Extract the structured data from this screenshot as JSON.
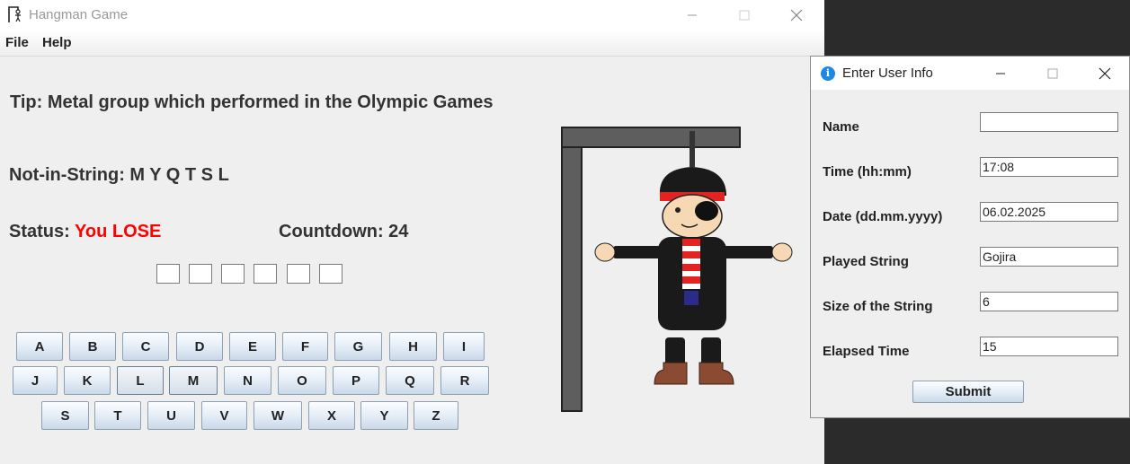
{
  "window": {
    "title": "Hangman Game",
    "icon": "hangman-icon"
  },
  "menu": {
    "items": [
      "File",
      "Help"
    ]
  },
  "game": {
    "tip": "Tip: Metal group which performed in the Olympic Games",
    "not_in_string": "Not-in-String: M Y Q T S L",
    "status_label": "Status:",
    "status_value": "You LOSE",
    "countdown": "Countdown: 24",
    "blanks": [
      "",
      "",
      "",
      "",
      "",
      ""
    ],
    "keyboard_rows": [
      [
        "A",
        "B",
        "C",
        "D",
        "E",
        "F",
        "G",
        "H",
        "I"
      ],
      [
        "J",
        "K",
        "L",
        "M",
        "N",
        "O",
        "P",
        "Q",
        "R"
      ],
      [
        "S",
        "T",
        "U",
        "V",
        "W",
        "X",
        "Y",
        "Z"
      ]
    ]
  },
  "dialog": {
    "title": "Enter User Info",
    "icon": "info-icon",
    "fields": [
      {
        "label": "Name",
        "value": ""
      },
      {
        "label": "Time (hh:mm)",
        "value": "17:08"
      },
      {
        "label": "Date (dd.mm.yyyy)",
        "value": "06.02.2025"
      },
      {
        "label": "Played String",
        "value": "Gojira"
      },
      {
        "label": "Size of the String",
        "value": "6"
      },
      {
        "label": "Elapsed Time",
        "value": "15"
      }
    ],
    "submit_label": "Submit"
  },
  "colors": {
    "lose": "#ff0000",
    "info": "#1e88e5"
  }
}
